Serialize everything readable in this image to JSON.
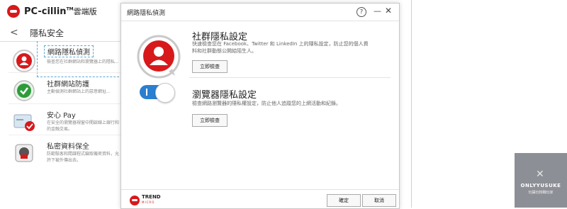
{
  "background_app": {
    "app_title": "PC-cillin",
    "app_title_tm": "TM",
    "app_title_suffix": "雲端版",
    "section_title": "隱私安全",
    "items": [
      {
        "title": "網路隱私偵測",
        "desc": "檢查您在社群網站和瀏覽器上的隱私..."
      },
      {
        "title": "社群網站防護",
        "desc": "主動偵測社群網站上的惡意網址..."
      },
      {
        "title": "安心 Pay",
        "desc": "在安全的瀏覽器視窗中開啟線上銀行和的金融交易。"
      },
      {
        "title": "私密資料保全",
        "desc": "防範駭客和間諜程式竊取機密資料，允許下被外傳出去。"
      }
    ]
  },
  "dialog": {
    "title": "網路隱私偵測",
    "help": "?",
    "minimize": "—",
    "close": "✕",
    "social": {
      "title": "社群隱私設定",
      "desc": "快速檢查您在 Facebook、Twitter 和 LinkedIn 上的隱私設定，防止您的個人資料和社群動態公開給陌生人。",
      "button": "立即檢查"
    },
    "browser": {
      "title": "瀏覽器隱私設定",
      "desc": "檢查網路瀏覽器的隱私權設定，防止他人追蹤您的上網活動和紀錄。",
      "button": "立即檢查",
      "toggle_on": true
    },
    "footer": {
      "brand": "TREND",
      "brand_sub": "MICRO",
      "ok": "確定",
      "cancel": "取消"
    }
  },
  "watermark": {
    "title": "ONLYYUSUKE",
    "subtitle": "玩攝玩物職玩家"
  },
  "colors": {
    "brand_red": "#d7191c",
    "toggle_blue": "#2b7fd0",
    "selection_dashed": "#5aa7d6"
  }
}
